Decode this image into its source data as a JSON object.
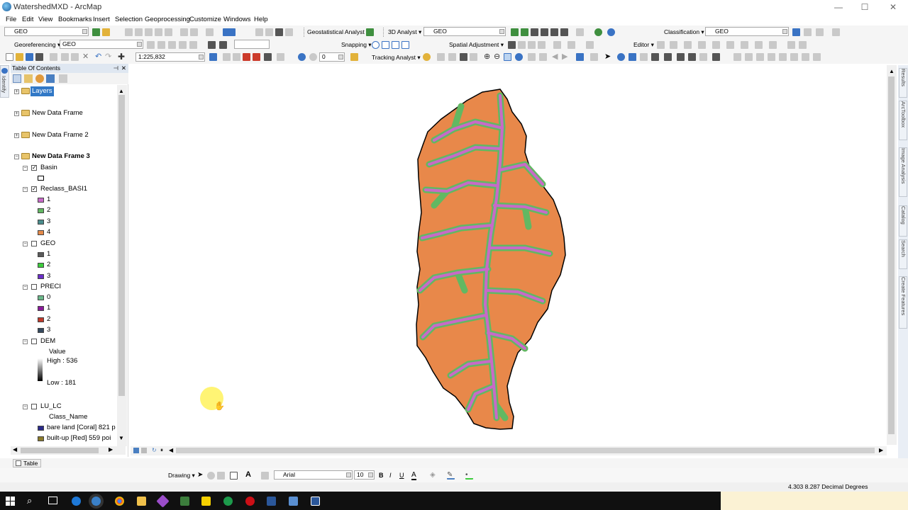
{
  "window": {
    "title": "WatershedMXD - ArcMap",
    "minimize": "—",
    "maximize": "☐",
    "close": "✕"
  },
  "menu": [
    "File",
    "Edit",
    "View",
    "Bookmarks",
    "Insert",
    "Selection",
    "Geoprocessing",
    "Customize",
    "Windows",
    "Help"
  ],
  "toolbar1": {
    "layer_combo": "GEO",
    "geostat_label": "Geostatistical Analyst ▾",
    "analyst3d_label": "3D Analyst ▾",
    "analyst3d_combo": "GEO",
    "classification_label": "Classification ▾",
    "classification_combo": "GEO"
  },
  "toolbar2": {
    "georef_label": "Georeferencing ▾",
    "georef_combo": "GEO",
    "snapping_label": "Snapping ▾",
    "spatial_adj_label": "Spatial Adjustment ▾",
    "editor_label": "Editor ▾"
  },
  "toolbar3": {
    "scale": "1:225,832",
    "angle": "0",
    "tracking_label": "Tracking Analyst ▾"
  },
  "toc": {
    "title": "Table Of Contents",
    "frames": {
      "layers": "Layers",
      "frame1": "New Data Frame",
      "frame2": "New Data Frame 2",
      "frame3": "New Data Frame 3"
    },
    "basin": {
      "name": "Basin"
    },
    "reclass": {
      "name": "Reclass_BASI1",
      "classes": [
        {
          "label": "1",
          "color": "#c86ac8"
        },
        {
          "label": "2",
          "color": "#62b862"
        },
        {
          "label": "3",
          "color": "#4a8c8c"
        },
        {
          "label": "4",
          "color": "#e58a4a"
        }
      ]
    },
    "geo": {
      "name": "GEO",
      "classes": [
        {
          "label": "1",
          "color": "#5a5a5a"
        },
        {
          "label": "2",
          "color": "#3ccc3c"
        },
        {
          "label": "3",
          "color": "#6a2dc8"
        }
      ]
    },
    "preci": {
      "name": "PRECI",
      "classes": [
        {
          "label": "0",
          "color": "#6ab88a"
        },
        {
          "label": "1",
          "color": "#8a1a9a"
        },
        {
          "label": "2",
          "color": "#c0392b"
        },
        {
          "label": "3",
          "color": "#34495e"
        }
      ]
    },
    "dem": {
      "name": "DEM",
      "value_label": "Value",
      "high": "High : 536",
      "low": "Low : 181"
    },
    "lulc": {
      "name": "LU_LC",
      "field": "Class_Name",
      "classes": [
        {
          "label": "bare land [Coral] 821 p",
          "color": "#2a2a8a"
        },
        {
          "label": "built-up [Red] 559 poi",
          "color": "#8a7a2a"
        }
      ]
    }
  },
  "side": {
    "identify": "Identify",
    "results": "Results",
    "arctoolbox": "ArcToolbox",
    "image_analysis": "Image Analysis",
    "catalog": "Catalog",
    "search": "Search",
    "create_features": "Create Features"
  },
  "bottom": {
    "table_label": "Table",
    "drawing_label": "Drawing ▾",
    "font": "Arial",
    "font_size": "10",
    "bold": "B",
    "italic": "I",
    "underline": "U",
    "font_color": "A",
    "status_coords": "4.303  8.287 Decimal Degrees"
  },
  "map": {
    "colors": {
      "orange": "#e8884a",
      "green": "#62b862",
      "magenta": "#c86ac8"
    }
  }
}
